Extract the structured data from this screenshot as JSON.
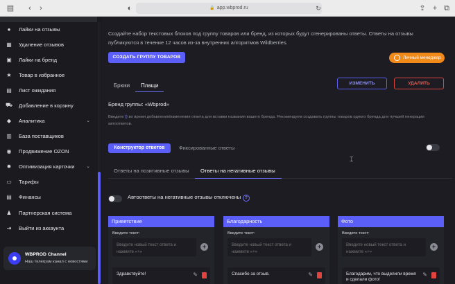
{
  "browser": {
    "url": "app.wbprod.ru"
  },
  "sidebar": {
    "items": [
      {
        "label": "Лайки на отзывы",
        "icon": "thumbs-up-icon"
      },
      {
        "label": "Удаление отзывов",
        "icon": "trash-icon"
      },
      {
        "label": "Лайки на бренд",
        "icon": "heart-icon"
      },
      {
        "label": "Товар в избранное",
        "icon": "star-icon"
      },
      {
        "label": "Лист ожидания",
        "icon": "clock-icon"
      },
      {
        "label": "Добавление в корзину",
        "icon": "cart-icon"
      },
      {
        "label": "Аналитика",
        "icon": "chart-icon"
      },
      {
        "label": "База поставщиков",
        "icon": "database-icon"
      },
      {
        "label": "Продвижение OZON",
        "icon": "ozon-icon"
      },
      {
        "label": "Оптимизация карточки",
        "icon": "gear-icon"
      },
      {
        "label": "Тарифы",
        "icon": "wallet-icon"
      },
      {
        "label": "Финансы",
        "icon": "finance-icon"
      },
      {
        "label": "Партнерская система",
        "icon": "partners-icon"
      },
      {
        "label": "Выйти из аккаунта",
        "icon": "logout-icon"
      }
    ],
    "channel": {
      "title": "WBPROD Channel",
      "subtitle": "Наш телеграм канал с новостями"
    }
  },
  "main": {
    "description": "Создайте набор текстовых блоков под группу товаров или бренд, из которых будут сгенерированы ответы. Ответы на отзывы публикуются в течение 12 часов из-за внутренних алгоритмов Wildberries.",
    "create_group_label": "СОЗДАТЬ ГРУППУ ТОВАРОВ",
    "manager_label": "Личный менеджер",
    "group_tabs": [
      "Брюки",
      "Плащи"
    ],
    "edit_label": "ИЗМЕНИТЬ",
    "delete_label": "УДАЛИТЬ",
    "brand_group": "Бренд группы: «Wbprod»",
    "hint_pre": "Введите ",
    "hint_highlight": "{}",
    "hint_post": " во время добавления/изменения ответа для вставки названия вашего бренда. Рекомендуем создавать группы товаров одного бренда для лучшей генерации автоответов.",
    "constructor_label": "Конструктор ответов",
    "fixed_label": "Фиксированные ответы",
    "review_tabs": [
      "Ответы на позитивные отзывы",
      "Ответы на негативные отзывы"
    ],
    "autoreply_status": "Автоответы на негативные отзывы отключены",
    "help_mark": "?"
  },
  "columns": [
    {
      "title": "Приветствие",
      "input_label": "Введите текст:",
      "placeholder": "Введите новый текст ответа и нажмите «+»",
      "item": "Здравствуйте!"
    },
    {
      "title": "Благодарность",
      "input_label": "Введите текст:",
      "placeholder": "Введите новый текст ответа и нажмите «+»",
      "item": "Спасибо за отзыв."
    },
    {
      "title": "Фото",
      "input_label": "Введите текст:",
      "placeholder": "Введите новый текст ответа и нажмите «+»",
      "item": "Благодарим, что выделили время и сделали фото!"
    }
  ],
  "colors": {
    "accent": "#5b5ef7",
    "danger": "#e0443f",
    "manager": "#f28a1a",
    "background": "#1c1c22"
  }
}
